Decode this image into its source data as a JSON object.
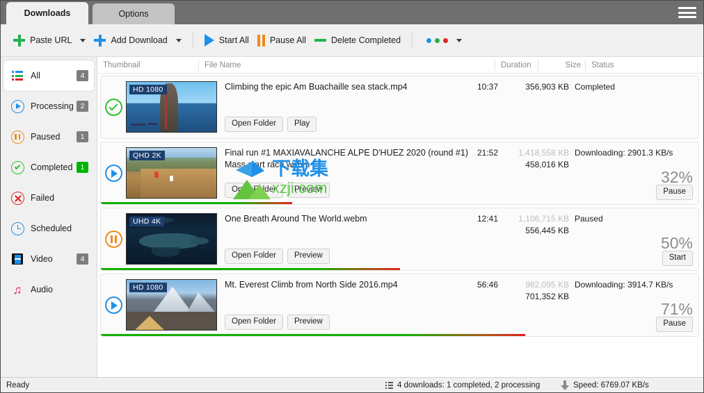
{
  "window": {
    "tabs": [
      {
        "label": "Downloads",
        "active": true
      },
      {
        "label": "Options",
        "active": false
      }
    ],
    "menu_icon": "hamburger-icon"
  },
  "toolbar": {
    "paste_url": "Paste URL",
    "add_download": "Add Download",
    "start_all": "Start All",
    "pause_all": "Pause All",
    "delete_completed": "Delete Completed",
    "colors": {
      "green": "#22b14c",
      "blue": "#1e90e8",
      "orange": "#f28a1b",
      "red": "#e02525"
    },
    "more_dots": [
      "#1e90e8",
      "#22b14c",
      "#e02525"
    ]
  },
  "sidebar": {
    "items": [
      {
        "label": "All",
        "icon": "list-icon",
        "badge": "4",
        "badge_style": "grey",
        "selected": true
      },
      {
        "label": "Processing",
        "icon": "play-circle-icon",
        "badge": "2",
        "badge_style": "grey",
        "selected": false
      },
      {
        "label": "Paused",
        "icon": "pause-circle-icon",
        "badge": "1",
        "badge_style": "grey",
        "selected": false
      },
      {
        "label": "Completed",
        "icon": "check-circle-icon",
        "badge": "1",
        "badge_style": "green",
        "selected": false
      },
      {
        "label": "Failed",
        "icon": "error-circle-icon",
        "badge": "",
        "badge_style": "none",
        "selected": false
      },
      {
        "label": "Scheduled",
        "icon": "clock-icon",
        "badge": "",
        "badge_style": "none",
        "selected": false
      },
      {
        "label": "Video",
        "icon": "film-icon",
        "badge": "4",
        "badge_style": "grey",
        "selected": false
      },
      {
        "label": "Audio",
        "icon": "music-note-icon",
        "badge": "",
        "badge_style": "none",
        "selected": false
      }
    ]
  },
  "table": {
    "headers": {
      "thumbnail": "Thumbnail",
      "file_name": "File Name",
      "duration": "Duration",
      "size": "Size",
      "status": "Status"
    },
    "rows": [
      {
        "state_icon": "check-circle-icon",
        "quality_badge": "HD 1080",
        "file_name": "Climbing the epic Am Buachaille sea stack.mp4",
        "duration": "10:37",
        "size_total": "356,903 KB",
        "size_done": "",
        "status": "Completed",
        "percent": "",
        "progress": 100,
        "show_progress": false,
        "buttons": [
          "Open Folder",
          "Play"
        ],
        "action_button": ""
      },
      {
        "state_icon": "play-circle-icon",
        "quality_badge": "QHD 2K",
        "file_name": "Final run #1  MAXIAVALANCHE ALPE D'HUEZ 2020 (round #1) Mass start race.webm",
        "duration": "21:52",
        "size_total": "1,418,558 KB",
        "size_done": "458,016 KB",
        "status": "Downloading: 2901.3 KB/s",
        "percent": "32%",
        "progress": 32,
        "show_progress": true,
        "buttons": [
          "Open Folder",
          "Preview"
        ],
        "action_button": "Pause"
      },
      {
        "state_icon": "pause-circle-icon",
        "quality_badge": "UHD 4K",
        "file_name": "One Breath Around The World.webm",
        "duration": "12:41",
        "size_total": "1,106,715 KB",
        "size_done": "556,445 KB",
        "status": "Paused",
        "percent": "50%",
        "progress": 50,
        "show_progress": true,
        "buttons": [
          "Open Folder",
          "Preview"
        ],
        "action_button": "Start"
      },
      {
        "state_icon": "play-circle-icon",
        "quality_badge": "HD 1080",
        "file_name": "Mt. Everest Climb from North Side 2016.mp4",
        "duration": "56:46",
        "size_total": "982,095 KB",
        "size_done": "701,352 KB",
        "status": "Downloading: 3914.7 KB/s",
        "percent": "71%",
        "progress": 71,
        "show_progress": true,
        "buttons": [
          "Open Folder",
          "Preview"
        ],
        "action_button": "Pause"
      }
    ]
  },
  "statusbar": {
    "ready": "Ready",
    "downloads_summary": "4 downloads: 1 completed, 2 processing",
    "speed": "Speed: 6769.07 KB/s"
  },
  "watermark": {
    "cn": "下载集",
    "en": "xzji.com"
  }
}
